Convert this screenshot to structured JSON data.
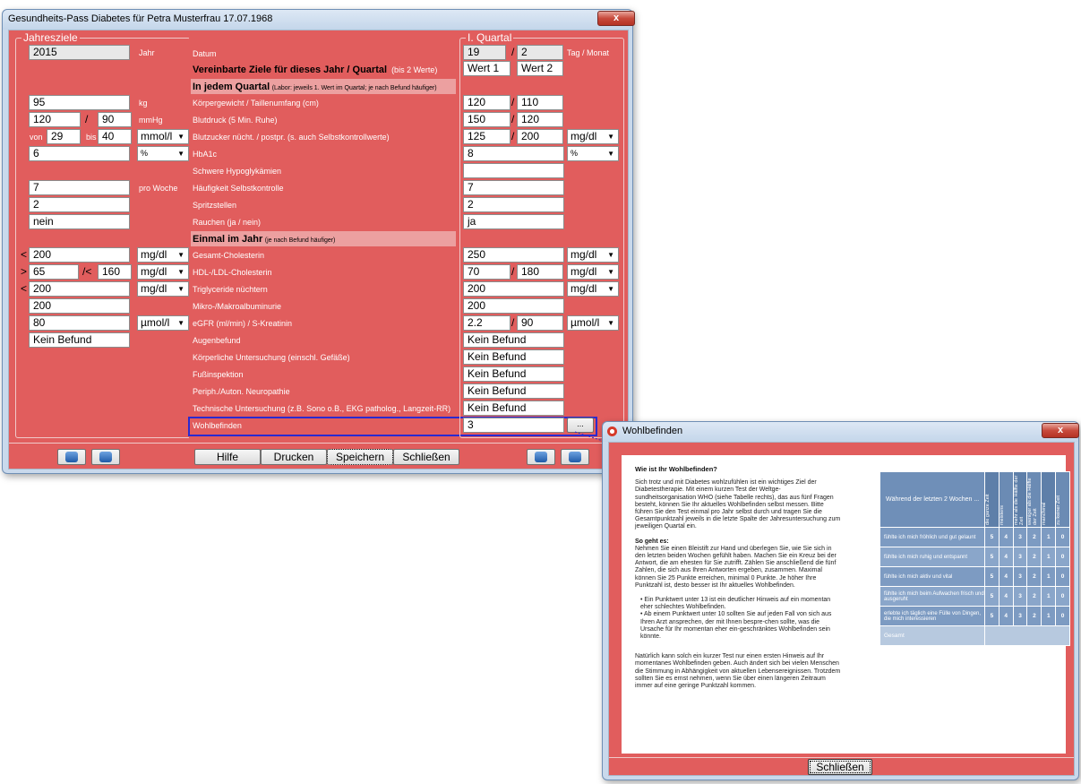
{
  "main": {
    "title": "Gesundheits-Pass Diabetes für Petra Musterfrau 17.07.1968",
    "close": "x",
    "goals": {
      "group_label": "Jahresziele",
      "year": "2015",
      "year_unit": "Jahr",
      "weight": "95",
      "weight_unit": "kg",
      "bp_sys": "120",
      "bp_slash": "/",
      "bp_dia": "90",
      "bp_unit": "mmHg",
      "bz_from_label": "von",
      "bz_from": "29",
      "bz_to_label": "bis",
      "bz_to": "40",
      "bz_unit": "mmol/l",
      "hba1c": "6",
      "hba1c_unit": "%",
      "selfcheck": "7",
      "selfcheck_unit": "pro Woche",
      "injection": "2",
      "smoking": "nein",
      "chol_op": "<",
      "chol": "200",
      "chol_unit": "mg/dl",
      "hdl_op": ">",
      "hdl": "65",
      "ldl_op": "/<",
      "ldl": "160",
      "ldl_unit": "mg/dl",
      "trig_op": "<",
      "trig": "200",
      "trig_unit": "mg/dl",
      "albu": "200",
      "egfr": "80",
      "egfr_unit": "µmol/l",
      "eye": "Kein Befund"
    },
    "labels": {
      "datum": "Datum",
      "ziele": "Vereinbarte Ziele für dieses Jahr / Quartal",
      "ziele_note": "(bis 2 Werte)",
      "jedes_quartal": "In jedem Quartal",
      "jedes_quartal_note": "(Labor: jeweils 1. Wert im Quartal; je nach Befund häufiger)",
      "gewicht": "Körpergewicht / Taillenumfang (cm)",
      "blutdruck": "Blutdruck (5 Min. Ruhe)",
      "blutzucker": "Blutzucker nücht. / postpr. (s. auch Selbstkontrollwerte)",
      "hba1c": "HbA1c",
      "hypo": "Schwere Hypoglykämien",
      "selbst": "Häufigkeit Selbstkontrolle",
      "spritz": "Spritzstellen",
      "rauchen": "Rauchen (ja / nein)",
      "einmal": "Einmal im Jahr",
      "einmal_note": "(je nach Befund häufiger)",
      "chol": "Gesamt-Cholesterin",
      "hdl": "HDL-/LDL-Cholesterin",
      "trig": "Triglyceride nüchtern",
      "albu": "Mikro-/Makroalbuminurie",
      "egfr": "eGFR (ml/min) / S-Kreatinin",
      "auge": "Augenbefund",
      "koerper": "Körperliche Untersuchung (einschl. Gefäße)",
      "fuss": "Fußinspektion",
      "neuro": "Periph./Auton. Neuropathie",
      "technisch": "Technische Untersuchung (z.B. Sono o.B., EKG patholog., Langzeit-RR)",
      "wohl": "Wohlbefinden"
    },
    "quarter": {
      "group_label": "I. Quartal",
      "day": "19",
      "month_sep": "/",
      "month": "2",
      "date_unit": "Tag / Monat",
      "wert1": "Wert 1",
      "wert2": "Wert 2",
      "weight": "120",
      "waist": "110",
      "bp_sys": "150",
      "bp_dia": "120",
      "bz_n": "125",
      "bz_p": "200",
      "bz_unit": "mg/dl",
      "hba1c": "8",
      "hba1c_unit": "%",
      "hypo": "",
      "selfcheck": "7",
      "injection": "2",
      "smoking": "ja",
      "chol": "250",
      "chol_unit": "mg/dl",
      "hdl": "70",
      "ldl": "180",
      "ldl_unit": "mg/dl",
      "trig": "200",
      "trig_unit": "mg/dl",
      "albu": "200",
      "egfr": "2.2",
      "krea": "90",
      "egfr_unit": "µmol/l",
      "auge": "Kein Befund",
      "koerper": "Kein Befund",
      "fuss": "Kein Befund",
      "neuro": "Kein Befund",
      "technisch": "Kein Befund",
      "wohl": "3",
      "wohl_btn": "..."
    },
    "buttons": {
      "hilfe": "Hilfe",
      "drucken": "Drucken",
      "speichern": "Speichern",
      "schliessen": "Schließen"
    }
  },
  "popup": {
    "title": "Wohlbefinden",
    "close": "x",
    "heading": "Wie ist Ihr Wohlbefinden?",
    "intro": "Sich trotz und mit Diabetes wohlzufühlen ist ein wichtiges Ziel der Diabetestherapie. Mit einem kurzen Test der Weltge-sundheitsorganisation WHO (siehe Tabelle rechts), das aus fünf Fragen besteht, können Sie Ihr aktuelles Wohlbefinden selbst messen. Bitte führen Sie den Test einmal pro Jahr selbst durch und tragen Sie die Gesamtpunktzahl jeweils in die letzte Spalte der Jahresuntersuchung zum jeweiligen Quartal ein.",
    "howto_heading": "So geht es:",
    "howto": "Nehmen Sie einen Bleistift zur Hand und überlegen Sie, wie Sie sich in den letzten beiden Wochen gefühlt haben. Machen Sie ein Kreuz bei der Antwort, die am ehesten für Sie zutrifft. Zählen Sie anschließend die fünf Zahlen, die sich aus Ihren Antworten ergeben, zusammen. Maximal können Sie 25 Punkte erreichen, minimal 0 Punkte. Je höher Ihre Punktzahl ist, desto besser ist Ihr aktuelles Wohlbefinden.",
    "bullet1": "• Ein Punktwert unter 13 ist ein deutlicher Hinweis auf ein momentan eher schlechtes Wohlbefinden.",
    "bullet2": "• Ab einem Punktwert unter 10 sollten Sie auf jeden Fall von sich aus Ihren Arzt ansprechen, der mit Ihnen bespre-chen sollte, was die Ursache für Ihr momentan eher ein-geschränktes Wohlbefinden sein könnte.",
    "outro": "Natürlich kann solch ein kurzer Test nur einen ersten Hinweis auf Ihr momentanes Wohlbefinden geben. Auch ändert sich bei vielen Menschen die Stimmung in Abhängigkeit von aktuellen Lebensereignissen. Trotzdem sollten Sie es ernst nehmen, wenn Sie über einen längeren Zeitraum immer auf eine geringe Punktzahl kommen.",
    "table_header": "Während der letzten 2 Wochen ...",
    "columns": [
      "die ganze Zeit",
      "meistens",
      "mehr als die Hälfte der Zeit",
      "weniger als die Hälfte der Zeit",
      "manchmal",
      "zu keiner Zeit"
    ],
    "rows": [
      {
        "label": "fühlte ich mich fröhlich und gut gelaunt",
        "s1": "5",
        "s2": "4",
        "s3": "3",
        "s4": "2",
        "s5": "1",
        "s6": "0"
      },
      {
        "label": "fühlte ich mich ruhig und entspannt",
        "s1": "5",
        "s2": "4",
        "s3": "3",
        "s4": "2",
        "s5": "1",
        "s6": "0"
      },
      {
        "label": "fühlte ich mich aktiv und vital",
        "s1": "5",
        "s2": "4",
        "s3": "3",
        "s4": "2",
        "s5": "1",
        "s6": "0"
      },
      {
        "label": "fühlte ich mich beim Aufwachen frisch und ausgeruht",
        "s1": "5",
        "s2": "4",
        "s3": "3",
        "s4": "2",
        "s5": "1",
        "s6": "0"
      },
      {
        "label": "erlebte ich täglich eine Fülle von Dingen, die mich interessieren",
        "s1": "5",
        "s2": "4",
        "s3": "3",
        "s4": "2",
        "s5": "1",
        "s6": "0"
      }
    ],
    "total_label": "Gesamt",
    "close_button": "Schließen"
  },
  "colors": {
    "panel": "#e15d5d",
    "header_row": "#eca0a0",
    "table": "#6f8fb8"
  }
}
